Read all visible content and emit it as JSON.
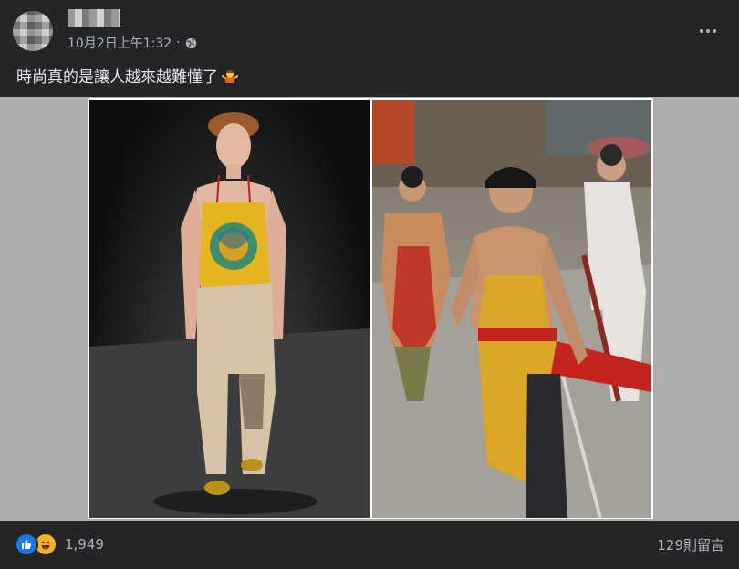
{
  "post": {
    "timestamp": "10月2日上午1:32",
    "separator": "·",
    "privacy_icon": "globe-icon",
    "more_icon": "ellipsis-icon",
    "text": "時尚真的是讓人越來越難懂了",
    "emoji_icon": "person-shrugging-emoji"
  },
  "footer": {
    "reaction_icons": [
      "like-icon",
      "haha-icon"
    ],
    "reaction_count": "1,949",
    "comment_count": "129則留言"
  },
  "colors": {
    "background": "#242526",
    "text_primary": "#e4e6eb",
    "text_secondary": "#b0b3b8",
    "like_blue": "#1877f2",
    "haha_yellow": "#f7b125"
  }
}
